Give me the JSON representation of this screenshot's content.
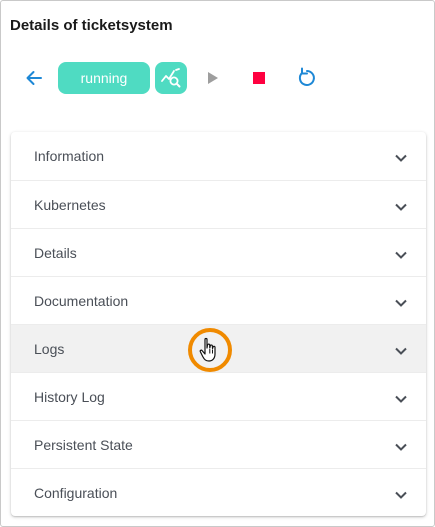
{
  "page": {
    "title": "Details of ticketsystem"
  },
  "toolbar": {
    "back_icon": "arrow-left-icon",
    "status_label": "running",
    "status_color": "#4fdbc2",
    "monitor_icon": "chart-search-icon",
    "play_icon": "play-icon",
    "stop_icon": "stop-icon",
    "stop_color": "#ff0040",
    "restart_icon": "restart-icon",
    "accent_color": "#1e88d6"
  },
  "accordion": {
    "items": [
      {
        "label": "Information"
      },
      {
        "label": "Kubernetes"
      },
      {
        "label": "Details"
      },
      {
        "label": "Documentation"
      },
      {
        "label": "Logs"
      },
      {
        "label": "History Log"
      },
      {
        "label": "Persistent State"
      },
      {
        "label": "Configuration"
      }
    ],
    "chevron_icon": "chevron-down-icon"
  },
  "cursor": {
    "icon": "hand-pointer-icon",
    "highlight_color": "#f08a00"
  }
}
